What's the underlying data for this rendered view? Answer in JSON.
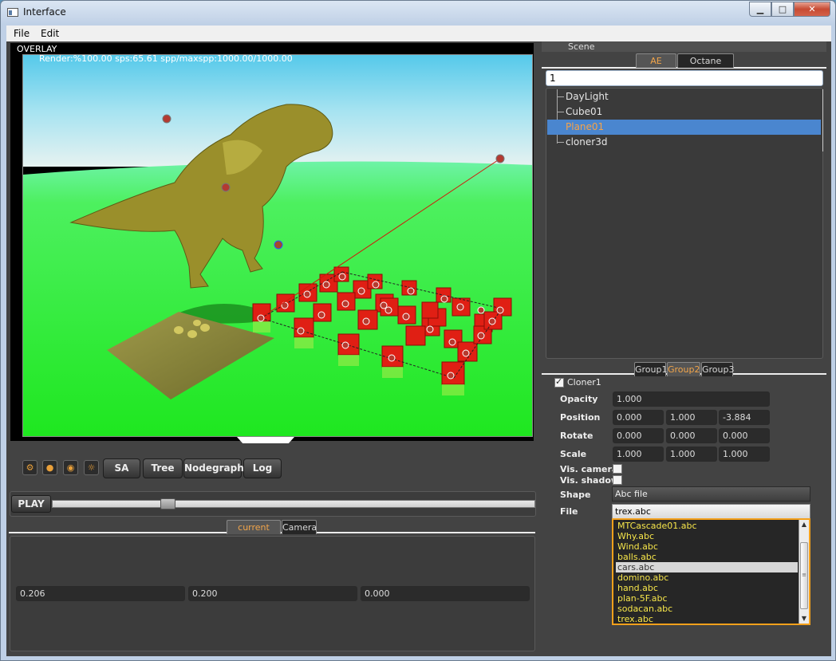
{
  "window": {
    "title": "Interface",
    "minimize": "▁",
    "maximize": "□",
    "close": "✕"
  },
  "menu": {
    "items": [
      "File",
      "Edit"
    ]
  },
  "viewport": {
    "overlay_label": "OVERLAY",
    "render_stats": "Render:%100.00  sps:65.61  spp/maxspp:1000.00/1000.00"
  },
  "toolbar": {
    "icons": [
      "render-settings-icon",
      "color-wheel-icon",
      "camera-icon",
      "light-icon"
    ],
    "buttons": [
      "SA",
      "Tree",
      "Nodegraph",
      "Log"
    ]
  },
  "timeline": {
    "play_label": "PLAY",
    "position": 0.23
  },
  "bottom_tabs": [
    {
      "label": "current node",
      "active": true
    },
    {
      "label": "Camera",
      "active": false
    }
  ],
  "bottom_values": [
    "0.206",
    "0.200",
    "0.000"
  ],
  "scene_panel": {
    "header": "Scene",
    "tabs": [
      {
        "label": "AE Scene",
        "active": true
      },
      {
        "label": "Octane nodes",
        "active": false
      }
    ],
    "search_value": "1",
    "tree_items": [
      {
        "label": "DayLight",
        "selected": false
      },
      {
        "label": "Cube01",
        "selected": false
      },
      {
        "label": "Plane01",
        "selected": true
      },
      {
        "label": "cloner3d",
        "selected": false
      }
    ]
  },
  "group_tabs": [
    {
      "label": "Group1",
      "active": false
    },
    {
      "label": "Group2",
      "active": true
    },
    {
      "label": "Group3",
      "active": false
    }
  ],
  "properties": {
    "cloner_label": "Cloner1",
    "cloner_checked": true,
    "opacity_label": "Opacity",
    "opacity": "1.000",
    "position_label": "Position",
    "position": [
      "0.000",
      "1.000",
      "-3.884"
    ],
    "rotate_label": "Rotate",
    "rotate": [
      "0.000",
      "0.000",
      "0.000"
    ],
    "scale_label": "Scale",
    "scale": [
      "1.000",
      "1.000",
      "1.000"
    ],
    "vis_camera_label": "Vis. camera",
    "vis_shadow_label": "Vis. shadow",
    "shape_label": "Shape",
    "shape_value": "Abc file",
    "file_label": "File",
    "file_value": "trex.abc",
    "file_options": [
      {
        "label": "MTCascade01.abc",
        "selected": false
      },
      {
        "label": "Why.abc",
        "selected": false
      },
      {
        "label": "Wind.abc",
        "selected": false
      },
      {
        "label": "balls.abc",
        "selected": false
      },
      {
        "label": "cars.abc",
        "selected": true
      },
      {
        "label": "domino.abc",
        "selected": false
      },
      {
        "label": "hand.abc",
        "selected": false
      },
      {
        "label": "plan-5F.abc",
        "selected": false
      },
      {
        "label": "sodacan.abc",
        "selected": false
      },
      {
        "label": "trex.abc",
        "selected": false
      }
    ]
  },
  "colors": {
    "accent": "#f4a01b",
    "selection": "#4a86cf",
    "dropdown_text": "#f7e64a"
  }
}
